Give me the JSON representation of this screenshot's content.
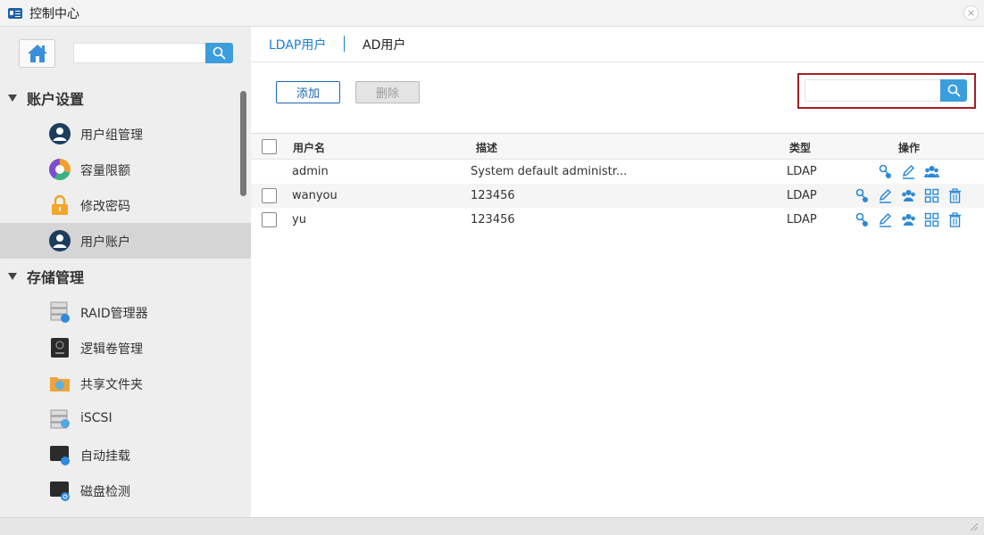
{
  "window": {
    "title": "控制中心",
    "close_glyph": "×"
  },
  "sidebar": {
    "sections": [
      {
        "label": "账户设置"
      },
      {
        "label": "存储管理"
      }
    ],
    "items": [
      {
        "label": "用户组管理",
        "icon": "user-group-icon"
      },
      {
        "label": "容量限额",
        "icon": "quota-icon"
      },
      {
        "label": "修改密码",
        "icon": "lock-icon"
      },
      {
        "label": "用户账户",
        "icon": "user-account-icon",
        "active": true
      },
      {
        "label": "RAID管理器",
        "icon": "raid-icon"
      },
      {
        "label": "逻辑卷管理",
        "icon": "lvm-icon"
      },
      {
        "label": "共享文件夹",
        "icon": "shared-folder-icon"
      },
      {
        "label": "iSCSI",
        "icon": "iscsi-icon"
      },
      {
        "label": "自动挂载",
        "icon": "automount-icon"
      },
      {
        "label": "磁盘检测",
        "icon": "disk-check-icon"
      }
    ]
  },
  "tabs": [
    {
      "label": "LDAP用户",
      "active": true
    },
    {
      "label": "AD用户",
      "active": false
    }
  ],
  "toolbar": {
    "add_label": "添加",
    "delete_label": "删除"
  },
  "table": {
    "headers": {
      "username": "用户名",
      "description": "描述",
      "type": "类型",
      "actions": "操作"
    },
    "rows": [
      {
        "username": "admin",
        "description": "System default administr...",
        "type": "LDAP",
        "has_checkbox": false
      },
      {
        "username": "wanyou",
        "description": "123456",
        "type": "LDAP",
        "has_checkbox": true
      },
      {
        "username": "yu",
        "description": "123456",
        "type": "LDAP",
        "has_checkbox": true
      }
    ]
  },
  "colors": {
    "accent": "#1a7fd4",
    "search_button": "#3c9ddc",
    "highlight_frame": "#a21f25",
    "active_item": "#d5d5d5"
  }
}
